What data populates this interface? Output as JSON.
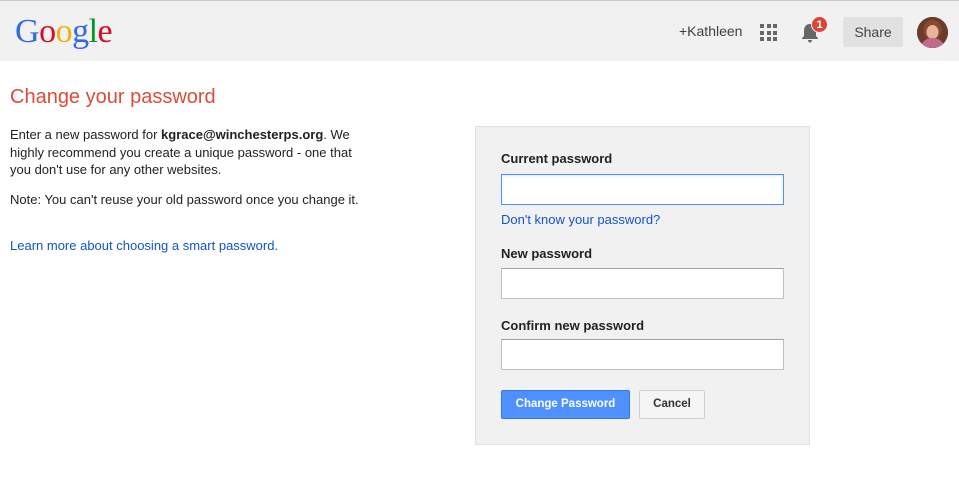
{
  "header": {
    "logo_letters": [
      {
        "char": "G",
        "color": "#3369e8"
      },
      {
        "char": "o",
        "color": "#d50f25"
      },
      {
        "char": "o",
        "color": "#eeb211"
      },
      {
        "char": "g",
        "color": "#3369e8"
      },
      {
        "char": "l",
        "color": "#009925"
      },
      {
        "char": "e",
        "color": "#d50f25"
      }
    ],
    "username": "+Kathleen",
    "notification_count": "1",
    "share_label": "Share",
    "icons": [
      "apps-grid-icon",
      "notification-bell-icon",
      "avatar"
    ]
  },
  "main": {
    "title": "Change your password",
    "intro_prefix": "Enter a new password for ",
    "email": "kgrace@winchesterps.org",
    "intro_suffix": ". We highly recommend you create a unique password - one that you don't use for any other websites.",
    "note": "Note: You can't reuse your old password once you change it.",
    "learn_more_link": "Learn more about choosing a smart password."
  },
  "form": {
    "current_password_label": "Current password",
    "current_password_value": "",
    "forgot_link": "Don't know your password?",
    "new_password_label": "New password",
    "new_password_value": "",
    "confirm_password_label": "Confirm new password",
    "confirm_password_value": "",
    "submit_label": "Change Password",
    "cancel_label": "Cancel"
  },
  "colors": {
    "title": "#dd4b39",
    "link": "#1155cc",
    "primary_button": "#4d90fe",
    "badge": "#db4437"
  }
}
